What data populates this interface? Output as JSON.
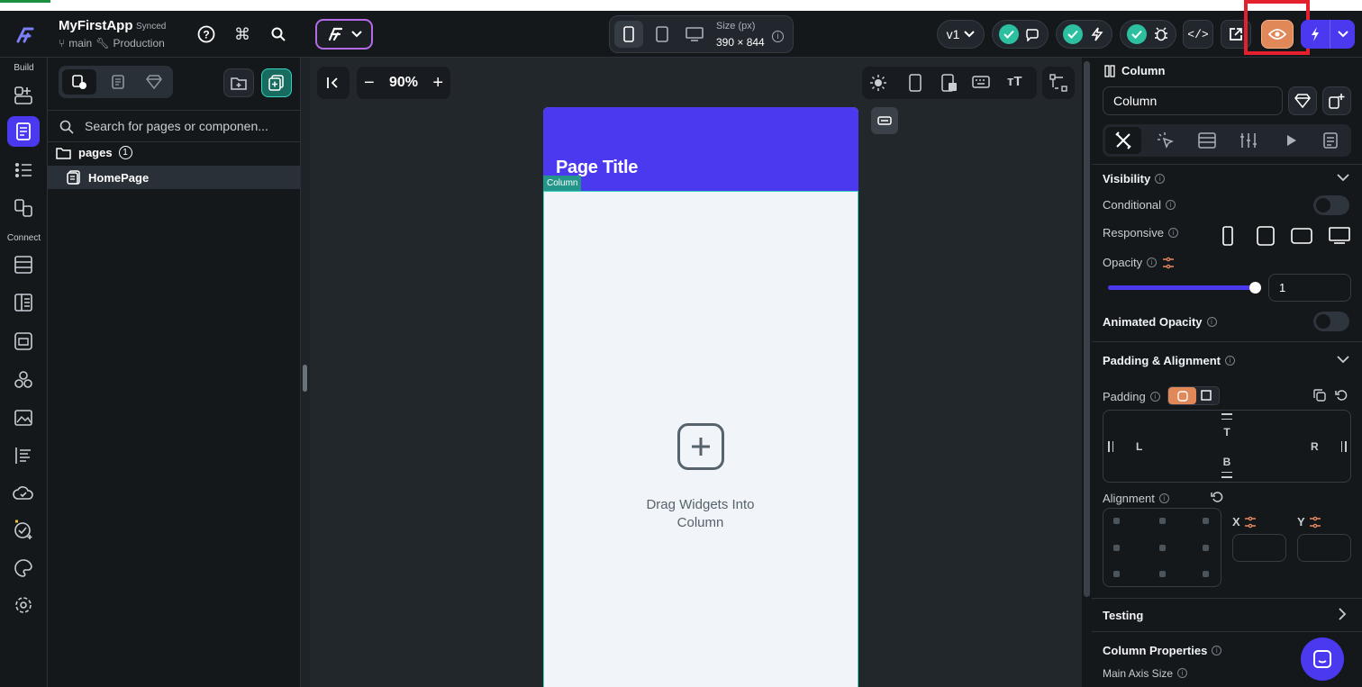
{
  "app": {
    "name": "MyFirstApp",
    "sync_status": "Synced",
    "branch": "main",
    "environment": "Production"
  },
  "device": {
    "size_label": "Size (px)",
    "size_value": "390 × 844"
  },
  "header_right": {
    "version": "v1"
  },
  "rail": {
    "build_label": "Build",
    "connect_label": "Connect"
  },
  "left_panel": {
    "search_placeholder": "Search for pages or componen...",
    "folder": "pages",
    "folder_count": "1",
    "pages": [
      {
        "label": "HomePage"
      }
    ]
  },
  "canvas": {
    "zoom": "90%",
    "page_title": "Page Title",
    "selection_tag": "Column",
    "empty_text_line1": "Drag Widgets Into",
    "empty_text_line2": "Column"
  },
  "right_panel": {
    "widget_type": "Column",
    "widget_name": "Column",
    "visibility": {
      "title": "Visibility",
      "conditional": "Conditional",
      "responsive": "Responsive",
      "opacity": "Opacity",
      "opacity_value": "1",
      "opacity_level": 1.0,
      "animated_opacity": "Animated Opacity"
    },
    "padding_alignment": {
      "title": "Padding & Alignment",
      "padding": "Padding",
      "t": "T",
      "b": "B",
      "l": "L",
      "r": "R",
      "alignment": "Alignment",
      "x": "X",
      "y": "Y"
    },
    "testing": "Testing",
    "column_properties": "Column Properties",
    "main_axis_size": "Main Axis Size"
  },
  "colors": {
    "accent_purple": "#4b39ef",
    "orange_highlight": "#e88a60",
    "teal_check": "#2dc0a0",
    "red_annotation": "#e5202e"
  }
}
